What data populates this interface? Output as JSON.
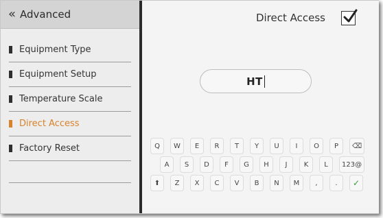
{
  "sidebar": {
    "title": "Advanced",
    "items": [
      {
        "label": "Equipment Type"
      },
      {
        "label": "Equipment Setup"
      },
      {
        "label": "Temperature Scale"
      },
      {
        "label": "Direct Access"
      },
      {
        "label": "Factory Reset"
      }
    ],
    "active_index": 3
  },
  "main": {
    "direct_access_label": "Direct Access",
    "direct_access_checked": true,
    "input_value": "HT"
  },
  "keyboard": {
    "row1": [
      "Q",
      "W",
      "E",
      "R",
      "T",
      "Y",
      "U",
      "I",
      "O",
      "P",
      "⌫"
    ],
    "row2": [
      "A",
      "S",
      "D",
      "F",
      "G",
      "H",
      "J",
      "K",
      "L",
      "123@"
    ],
    "row3": [
      "⬆",
      "Z",
      "X",
      "C",
      "V",
      "B",
      "N",
      "M",
      ",",
      ".",
      "✓"
    ]
  },
  "colors": {
    "accent": "#d9822b",
    "confirm": "#3a9a3a"
  }
}
